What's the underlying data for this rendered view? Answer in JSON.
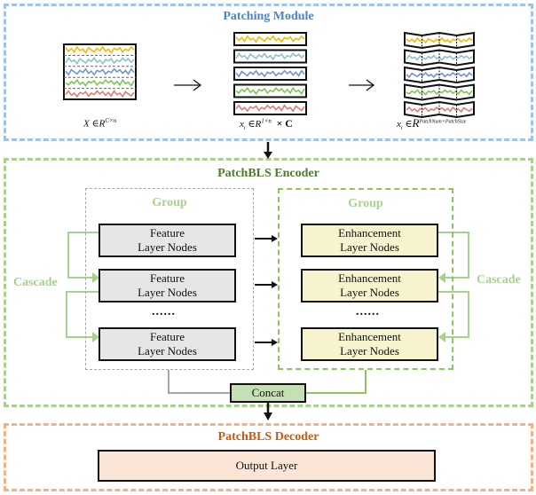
{
  "patching_module": {
    "title": "Patching Module",
    "formula_input": {
      "var": "X",
      "op": "∈",
      "space": "R",
      "exp": "C×n"
    },
    "formula_channel": {
      "var": "x",
      "sub": "i",
      "op": "∈",
      "space": "R",
      "exp": "1×n",
      "times": "× C"
    },
    "formula_patch": {
      "var": "x",
      "sub": "i",
      "op": "∈",
      "space": "R",
      "exp": "PatchNum×PatchSize"
    },
    "channel_colors": [
      "#f5b800",
      "#8fbfd0",
      "#6f96c8",
      "#7cc656",
      "#de7d73"
    ],
    "channel_count": 5,
    "patches_per_channel": 4
  },
  "encoder": {
    "title": "PatchBLS  Encoder",
    "left_group": {
      "label": "Group",
      "nodes": [
        {
          "line1": "Feature",
          "line2": "Layer Nodes"
        },
        {
          "line1": "Feature",
          "line2": "Layer Nodes"
        },
        {
          "line1": "Feature",
          "line2": "Layer Nodes"
        }
      ],
      "ellipsis": "......"
    },
    "right_group": {
      "label": "Group",
      "nodes": [
        {
          "line1": "Enhancement",
          "line2": "Layer Nodes"
        },
        {
          "line1": "Enhancement",
          "line2": "Layer Nodes"
        },
        {
          "line1": "Enhancement",
          "line2": "Layer Nodes"
        }
      ],
      "ellipsis": "......"
    },
    "cascade_left": "Cascade",
    "cascade_right": "Cascade",
    "concat": "Concat"
  },
  "decoder": {
    "title": "PatchBLS  Decoder",
    "output_layer": "Output Layer"
  }
}
